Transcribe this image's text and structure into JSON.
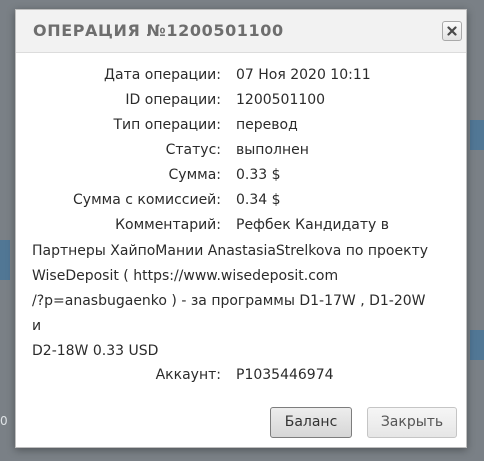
{
  "background": {
    "partial_text": "0"
  },
  "dialog": {
    "title": "ОПЕРАЦИЯ №1200501100",
    "close_icon": "close-x-icon",
    "fields": {
      "date_label": "Дата операции:",
      "date_value": "07 Ноя 2020 10:11",
      "id_label": "ID операции:",
      "id_value": "1200501100",
      "type_label": "Тип операции:",
      "type_value": "перевод",
      "status_label": "Статус:",
      "status_value": "выполнен",
      "sum_label": "Сумма:",
      "sum_value": "0.33 $",
      "sum_fee_label": "Сумма с комиссией:",
      "sum_fee_value": "0.34 $",
      "comment_label": "Комментарий:",
      "comment_first_line": "Рефбек Кандидату в",
      "comment_rest": "Партнеры ХайпоМании AnastasiaStrelkova по проекту\nWiseDeposit ( https://www.wisedeposit.com\n/?p=anasbugaenko ) - за программы D1-17W , D1-20W и\nD2-18W 0.33 USD",
      "account_label": "Аккаунт:",
      "account_value": "P1035446974"
    },
    "buttons": {
      "balance_label": "Баланс",
      "close_label": "Закрыть"
    }
  },
  "colors": {
    "backdrop": "#7a8086",
    "titlebar": "#f2f2f2",
    "title_text": "#6e6e6e",
    "body_text": "#2b2b2b"
  }
}
